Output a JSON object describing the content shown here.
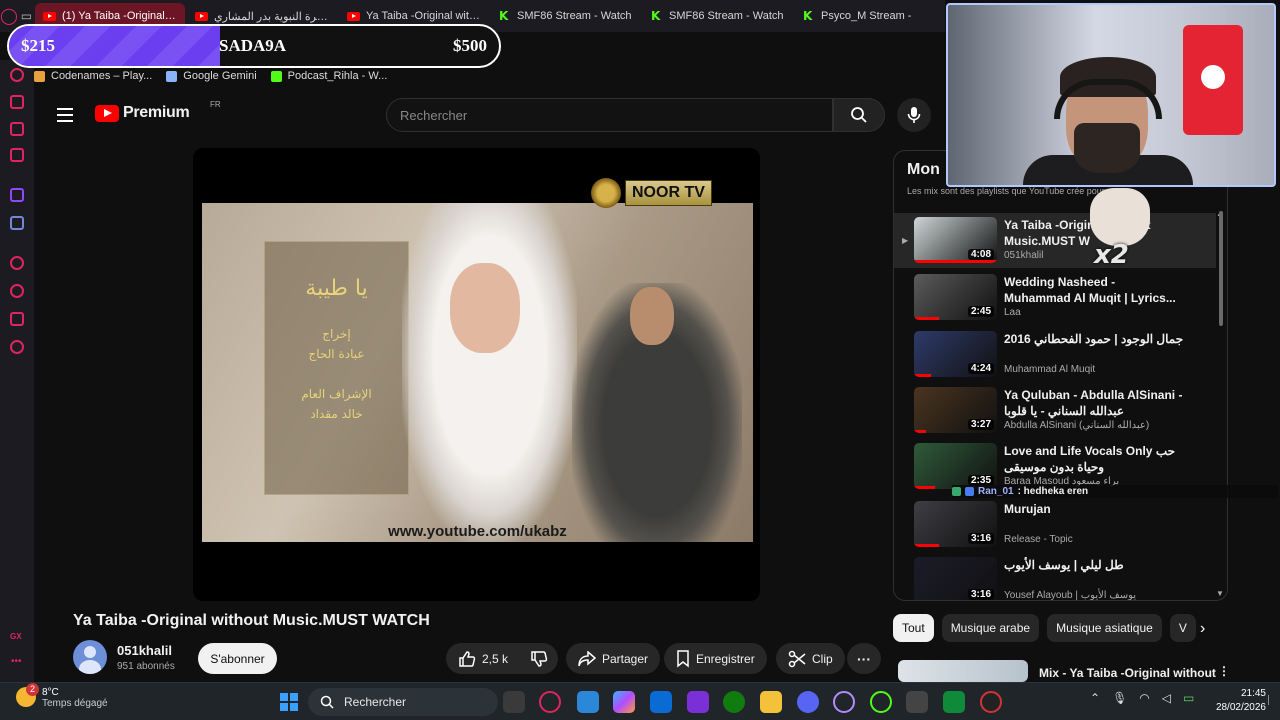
{
  "browser": {
    "tabs": [
      {
        "label": "(1) Ya Taiba -Original without",
        "kind": "youtube",
        "active": true
      },
      {
        "label": "السيرة النبوية بدر المشاري",
        "kind": "youtube",
        "active": false
      },
      {
        "label": "Ya Taiba -Original without",
        "kind": "youtube",
        "active": false
      },
      {
        "label": "SMF86 Stream - Watch",
        "kind": "kick",
        "active": false
      },
      {
        "label": "SMF86 Stream - Watch",
        "kind": "kick",
        "active": false
      },
      {
        "label": "Psyco_M Stream -",
        "kind": "kick",
        "active": false
      }
    ],
    "bookmarks": [
      {
        "label": "Codenames – Play...",
        "color": "#e8a33d"
      },
      {
        "label": "Google Gemini",
        "color": "#8ab4f8"
      },
      {
        "label": "Podcast_Rihla - W...",
        "color": "#53fc18"
      }
    ]
  },
  "goal": {
    "current": "$215",
    "name": "SADA9A",
    "target": "$500",
    "progress_fraction": 0.43
  },
  "youtube": {
    "logo_text": "Premium",
    "country_code": "FR",
    "search_placeholder": "Rechercher",
    "video": {
      "overlay_url": "www.youtube.com/ukabz",
      "channel_bug": "NOOR TV",
      "arabic_lines": [
        "يا طيبة",
        "إخراج",
        "عبادة الحاج",
        "الإشراف العام",
        "خالد مقداد"
      ]
    },
    "title": "Ya Taiba -Original without Music.MUST WATCH",
    "channel": {
      "name": "051khalil",
      "subs": "951 abonnés",
      "subscribe_label": "S'abonner"
    },
    "actions": {
      "likes": "2,5 k",
      "share": "Partager",
      "save": "Enregistrer",
      "clip": "Clip"
    },
    "mix": {
      "heading": "Mon",
      "subtitle": "Les mix sont des playlists que YouTube crée pour vous",
      "items": [
        {
          "title": "Ya Taiba -Original without Music.MUST W",
          "channel": "051khalil",
          "duration": "4:08",
          "current": true,
          "thumb": "#cfd6d8",
          "progress": 1
        },
        {
          "title": "Wedding Nasheed - Muhammad Al Muqit | Lyrics...",
          "channel": "Laa",
          "duration": "2:45",
          "current": false,
          "thumb": "#5b5b5b",
          "progress": 0.3
        },
        {
          "title": "جمال الوجود | حمود الفحطاني 2016",
          "channel": "Muhammad Al Muqit",
          "duration": "4:24",
          "current": false,
          "thumb": "#2e3b6a",
          "progress": 0.2
        },
        {
          "title": "Ya Quluban - Abdulla AlSinani - عبدالله السناني - يا قلوبا",
          "channel": "Abdulla AlSinani (عبدالله السناني)",
          "duration": "3:27",
          "current": false,
          "thumb": "#4a3520",
          "progress": 0.15
        },
        {
          "title": "Love and Life Vocals Only حب وحياة بدون موسيقى",
          "channel": "Baraa Masoud براء مسعود",
          "duration": "2:35",
          "current": false,
          "thumb": "#2f5b3a",
          "progress": 0.25
        },
        {
          "title": "Murujan",
          "channel": "Release - Topic",
          "duration": "3:16",
          "current": false,
          "thumb": "#3e3e44",
          "progress": 0.3
        },
        {
          "title": "طل ليلي | يوسف الأيوب",
          "channel": "Yousef Alayoub | يوسف الأيوب",
          "duration": "3:16",
          "current": false,
          "thumb": "#1c1c2a",
          "progress": 0.2
        }
      ]
    },
    "chips": [
      {
        "label": "Tout",
        "active": true
      },
      {
        "label": "Musique arabe",
        "active": false
      },
      {
        "label": "Musique asiatique",
        "active": false
      },
      {
        "label": "V",
        "active": false
      }
    ],
    "next_mix": "Mix - Ya Taiba -Original without"
  },
  "stream_overlay": {
    "multiplier": "x2",
    "chat_user": "Ran_01",
    "chat_message": ": hedheka eren"
  },
  "taskbar": {
    "weather_temp": "8°C",
    "weather_desc": "Temps dégagé",
    "notification_count": "2",
    "search_placeholder": "Rechercher",
    "time": "21:45",
    "date": "28/02/2026"
  }
}
